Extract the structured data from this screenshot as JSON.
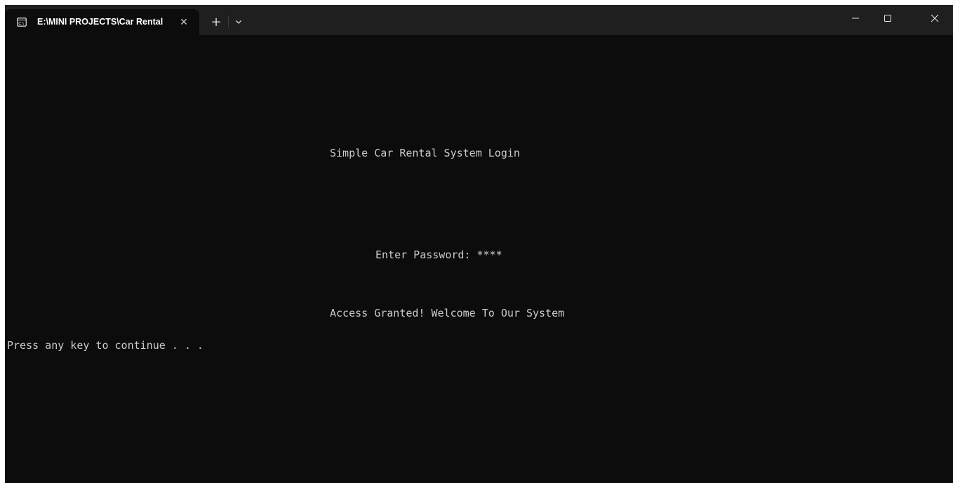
{
  "window": {
    "tab_title": "E:\\MINI PROJECTS\\Car Rental",
    "tab_close_glyph": "✕",
    "new_tab_glyph": "+",
    "dropdown_icon": "chevron-down-icon",
    "controls": {
      "minimize_icon": "minimize-icon",
      "maximize_icon": "maximize-icon",
      "close_icon": "close-icon"
    }
  },
  "terminal": {
    "heading": "Simple Car Rental System Login",
    "password_prompt": "Enter Password: ****",
    "access_message": "Access Granted! Welcome To Our System",
    "continue_prompt": "Press any key to continue . . ."
  },
  "colors": {
    "terminal_background": "#0c0c0c",
    "titlebar_background": "#1f1f1f",
    "terminal_text": "#cccccc"
  }
}
